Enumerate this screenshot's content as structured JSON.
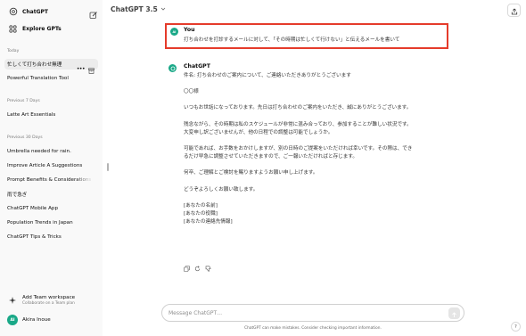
{
  "sidebar": {
    "brand_label": "ChatGPT",
    "explore_label": "Explore GPTs",
    "groups": [
      {
        "heading": "Today",
        "items": [
          {
            "title": "忙しくて打ち合わせ無理"
          },
          {
            "title": "Powerful Translation Tool"
          }
        ]
      },
      {
        "heading": "Previous 7 Days",
        "items": [
          {
            "title": "Latte Art Essentials"
          }
        ]
      },
      {
        "heading": "Previous 30 Days",
        "items": [
          {
            "title": "Umbrella needed for rain."
          },
          {
            "title": "Improve Article A Suggestions"
          },
          {
            "title": "Prompt Benefits & Considerations"
          },
          {
            "title": "雨で急ぎ"
          },
          {
            "title": "ChatGPT Mobile App"
          },
          {
            "title": "Population Trends in Japan"
          },
          {
            "title": "ChatGPT Tips & Tricks"
          }
        ]
      }
    ],
    "team": {
      "title": "Add Team workspace",
      "subtitle": "Collaborate on a Team plan"
    },
    "user": {
      "initials": "AI",
      "name": "Akira Inoue"
    }
  },
  "header": {
    "model_label": "ChatGPT 3.5"
  },
  "conversation": {
    "user_message": {
      "speaker": "You",
      "initials": "AI",
      "text": "打ち合わせを打診するメールに対して、「その時期は忙しくて行けない」と伝えるメールを書いて"
    },
    "assistant_message": {
      "speaker": "ChatGPT",
      "paragraphs": [
        "件名: 打ち合わせのご案内について、ご連絡いただきありがとうございます",
        "〇〇様",
        "いつもお世話になっております。先日は打ち合わせのご案内をいただき、誠にありがとうございます。",
        "残念ながら、その時期は私のスケジュールが非常に混み合っており、参加することが難しい状況です。\n大変申し訳ございませんが、他の日程での調整は可能でしょうか。",
        "可能であれば、お手数をおかけしますが、別の日時のご提案をいただければ幸いです。その際は、でき\nるだけ早急に調整させていただきますので、ご一報いただければと存じます。",
        "何卒、ご理解とご検討を賜りますようお願い申し上げます。",
        "どうぞよろしくお願い致します。",
        "[あなたの名前]\n[あなたの役職]\n[あなたの連絡先情報]"
      ]
    }
  },
  "composer": {
    "placeholder": "Message ChatGPT…"
  },
  "footer": {
    "disclaimer": "ChatGPT can make mistakes. Consider checking important information.",
    "help_label": "?"
  },
  "colors": {
    "accent": "#19a887",
    "highlight_border": "#e53b2b",
    "sidebar_bg": "#f9f9f9"
  }
}
